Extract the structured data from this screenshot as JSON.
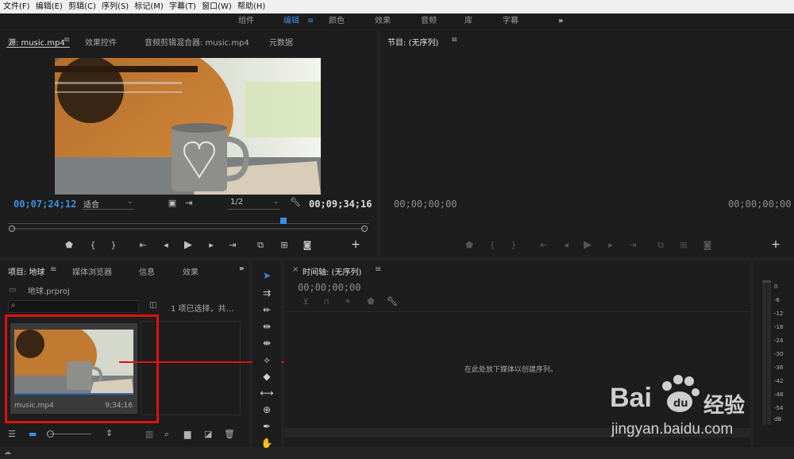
{
  "menu": [
    "文件(F)",
    "编辑(E)",
    "剪辑(C)",
    "序列(S)",
    "标记(M)",
    "字幕(T)",
    "窗口(W)",
    "帮助(H)"
  ],
  "workspaces": {
    "items": [
      "组件",
      "编辑",
      "颜色",
      "效果",
      "音频",
      "库",
      "字幕"
    ],
    "active": "编辑",
    "more": "»"
  },
  "source_panel": {
    "tabs": [
      "源: music.mp4",
      "效果控件",
      "音频剪辑混合器: music.mp4",
      "元数据"
    ],
    "timecode_current": "00;07;24;12",
    "fit_label": "适合",
    "resolution": "1/2",
    "timecode_duration": "00;09;34;16"
  },
  "program_panel": {
    "title": "节目: (无序列)",
    "timecode_left": "00;00;00;00",
    "timecode_right": "00;00;00;00"
  },
  "project_panel": {
    "tabs": [
      "项目: 地球",
      "媒体浏览器",
      "信息",
      "效果"
    ],
    "more": "»",
    "file": "地球.prproj",
    "selection_info": "1 项已选择，共…",
    "clip": {
      "name": "music.mp4",
      "duration": "9;34;16"
    }
  },
  "timeline_panel": {
    "title": "时间轴: (无序列)",
    "timecode": "00;00;00;00",
    "drop_hint": "在此处放下媒体以创建序列。"
  },
  "audio_meter": {
    "labels": [
      "0",
      "-6",
      "-12",
      "-18",
      "-24",
      "-30",
      "-36",
      "-42",
      "-48",
      "-54",
      "dB"
    ]
  },
  "watermark": {
    "brand_text": "Bai",
    "brand_cn": "经验",
    "url": "jingyan.baidu.com"
  },
  "colors": {
    "accent_blue": "#3b90e3",
    "annotation_red": "#e01010"
  }
}
